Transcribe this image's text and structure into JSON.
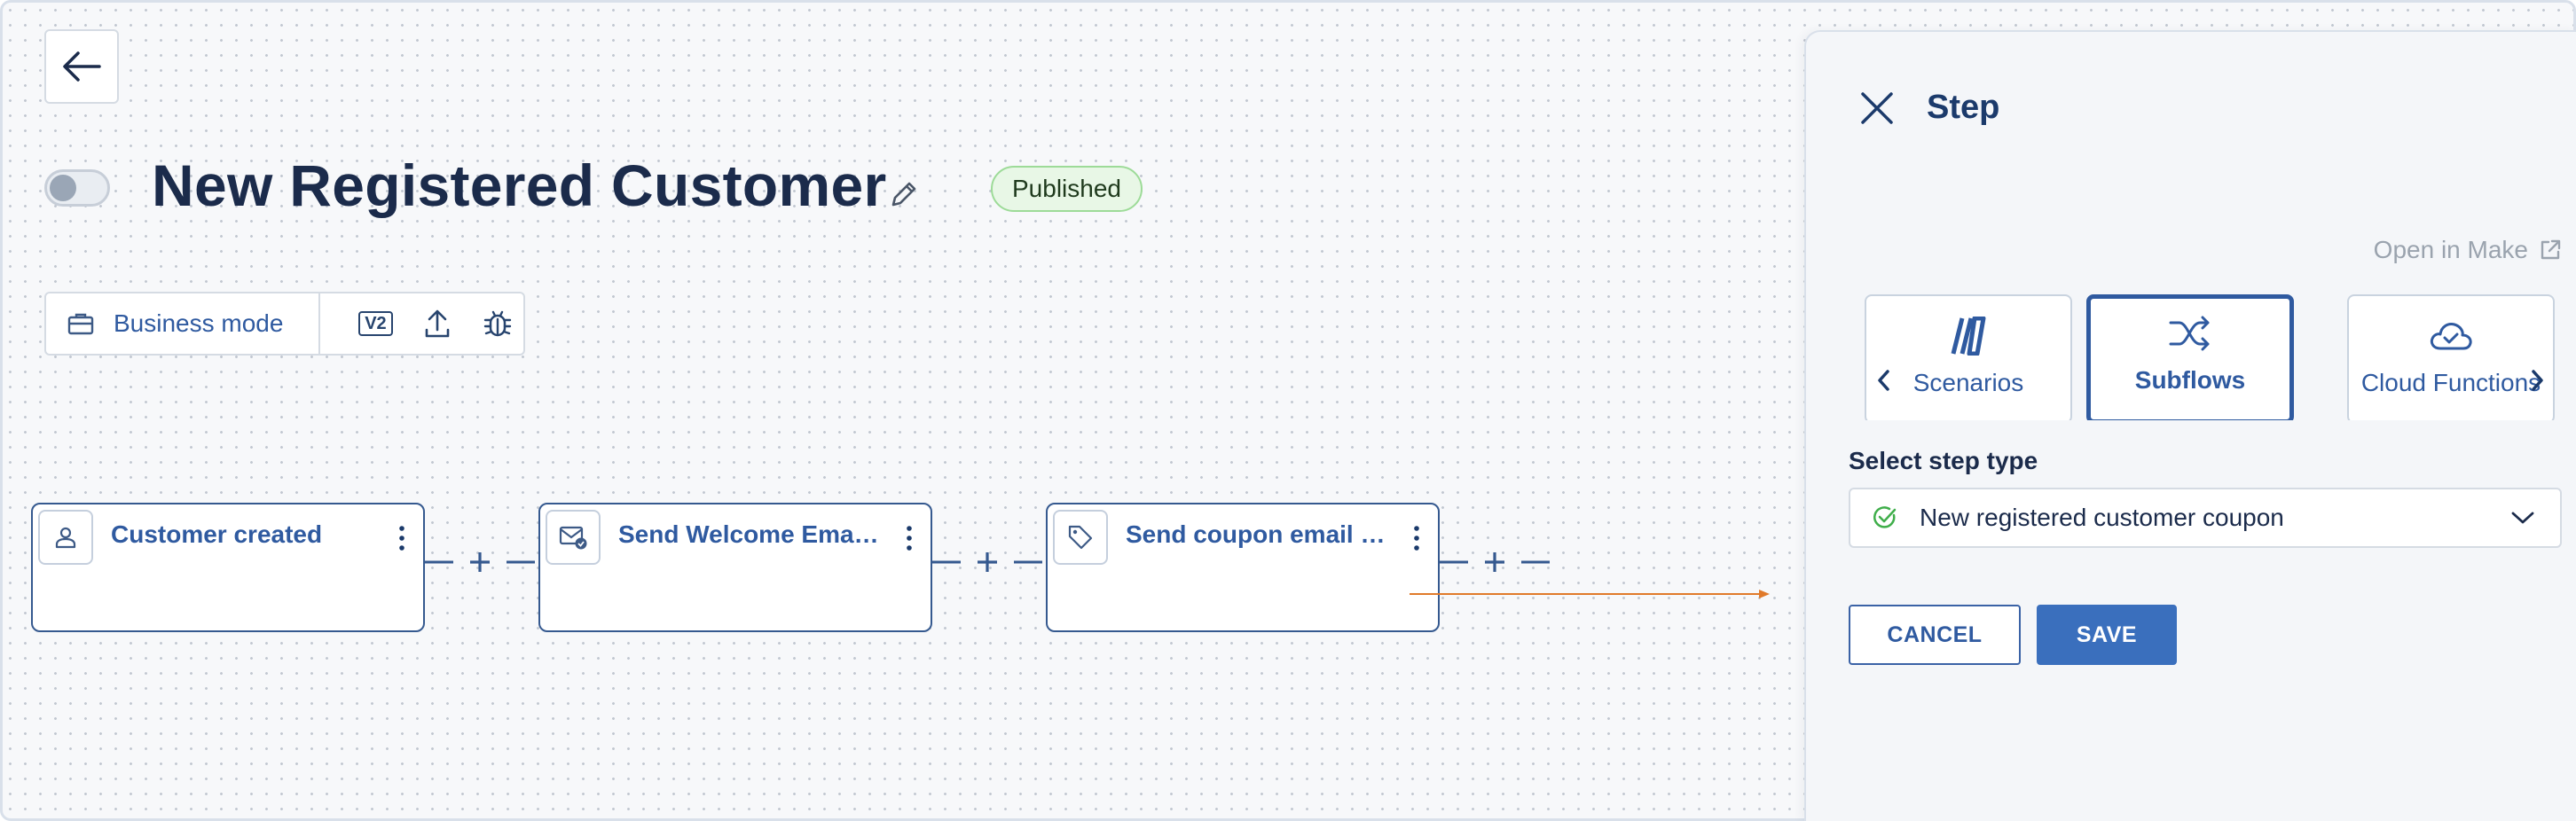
{
  "workflow": {
    "title": "New Registered Customer",
    "status": "Published",
    "enabled": false,
    "status_color": "#e8f7e6"
  },
  "toolbar": {
    "mode_label": "Business mode",
    "version_label": "V2",
    "tools": [
      "briefcase-icon",
      "version-icon",
      "upload-icon",
      "bug-icon"
    ]
  },
  "nodes": [
    {
      "title": "Customer created",
      "icon": "person-icon"
    },
    {
      "title": "Send Welcome Email to Customer",
      "icon": "email-icon"
    },
    {
      "title": "Send coupon email via Klaviyo",
      "icon": "tag-icon"
    }
  ],
  "panel": {
    "title": "Step",
    "open_make_label": "Open in Make",
    "step_types": [
      {
        "label": "Scenarios",
        "icon": "scenarios-icon",
        "selected": false
      },
      {
        "label": "Subflows",
        "icon": "shuffle-icon",
        "selected": true
      },
      {
        "label": "Cloud Functions",
        "icon": "cloud-icon",
        "selected": false
      }
    ],
    "select_label": "Select step type",
    "selected_value": "New registered customer coupon",
    "cancel_label": "CANCEL",
    "save_label": "SAVE"
  },
  "colors": {
    "accent": "#2f5aa0",
    "save_button": "#3a6fbd",
    "connector_arrow": "#e07a2a",
    "check": "#3fae4a"
  }
}
